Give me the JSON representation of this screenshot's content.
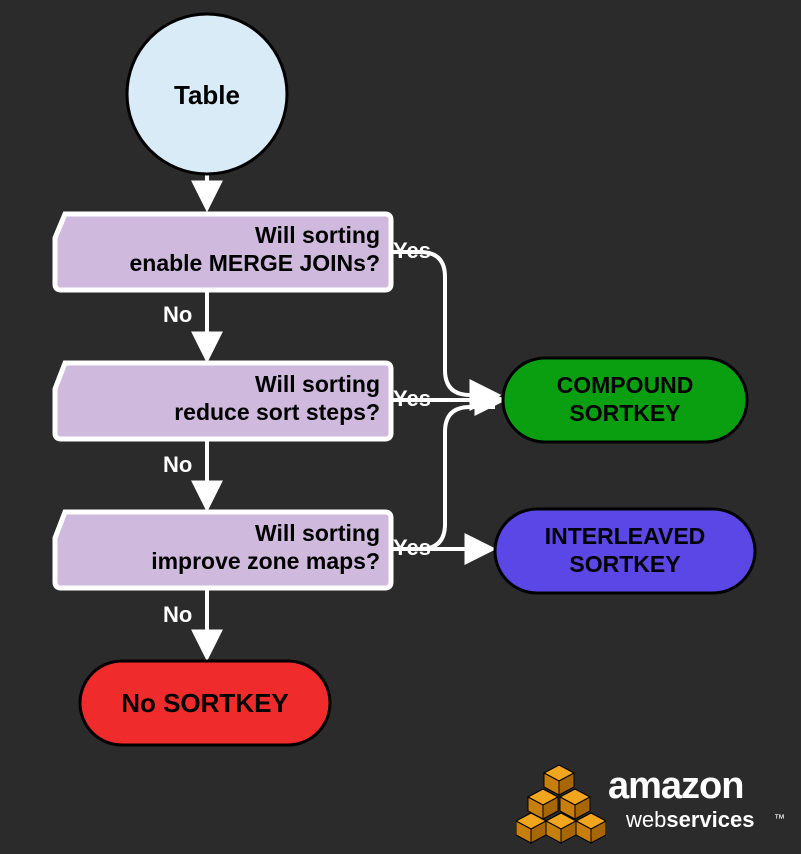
{
  "nodes": {
    "start": "Table",
    "q1_l1": "Will sorting",
    "q1_l2": "enable MERGE JOINs?",
    "q2_l1": "Will sorting",
    "q2_l2": "reduce sort steps?",
    "q3_l1": "Will sorting",
    "q3_l2": "improve zone maps?",
    "outCompound_l1": "COMPOUND",
    "outCompound_l2": "SORTKEY",
    "outInterleaved_l1": "INTERLEAVED",
    "outInterleaved_l2": "SORTKEY",
    "outNone": "No SORTKEY"
  },
  "edges": {
    "yes": "Yes",
    "no": "No"
  },
  "logo": {
    "main": "amazon",
    "sub_plain": "web",
    "sub_bold": "services",
    "tm": "™"
  }
}
